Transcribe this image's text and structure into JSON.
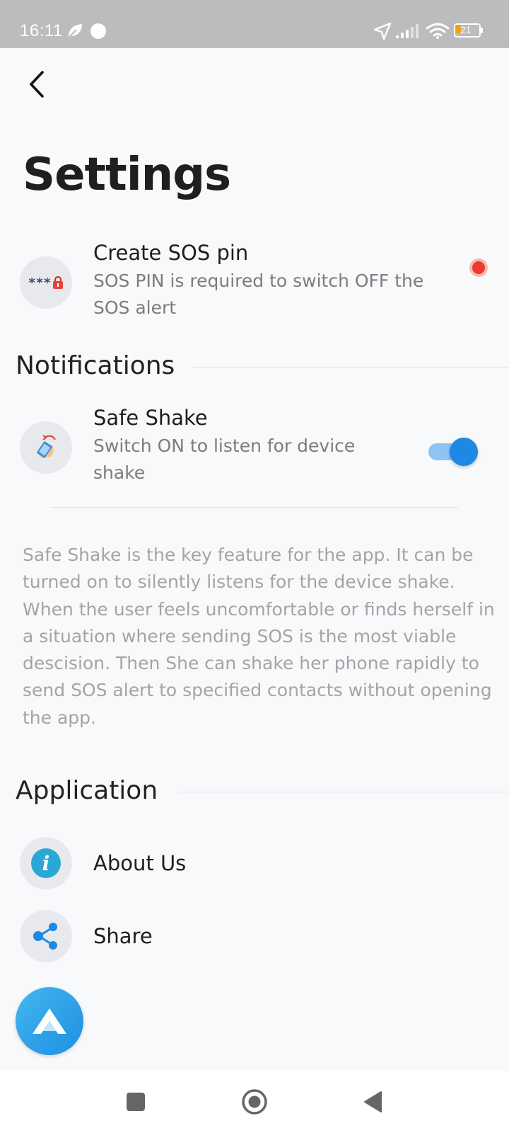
{
  "status_bar": {
    "time": "16:11",
    "battery_level": "21",
    "icons": [
      "leaf-icon",
      "circle-icon",
      "location-arrow-icon",
      "signal-icon",
      "wifi-icon",
      "battery-icon"
    ]
  },
  "header": {
    "back_icon": "chevron-left-icon",
    "title": "Settings"
  },
  "sos_pin": {
    "icon": "password-lock-icon",
    "icon_text": "***",
    "title": "Create SOS pin",
    "subtitle": "SOS PIN is required to switch OFF the SOS alert",
    "indicator_color": "#ec3b2b"
  },
  "notifications": {
    "section_title": "Notifications",
    "safe_shake": {
      "icon": "shake-phone-icon",
      "title": "Safe Shake",
      "subtitle": "Switch ON to listen for device shake",
      "enabled": true
    },
    "description": "Safe Shake is the key feature for the app. It can be turned on to silently listens for the device shake. When the user feels uncomfortable or finds herself in a situation where sending SOS is the most viable descision. Then She can shake her phone rapidly to send SOS alert to specified contacts without opening the app."
  },
  "application": {
    "section_title": "Application",
    "items": [
      {
        "icon": "info-icon",
        "label": "About Us"
      },
      {
        "icon": "share-icon",
        "label": "Share"
      }
    ]
  },
  "fab": {
    "icon": "app-logo-icon"
  },
  "nav_bar": {
    "buttons": [
      "recents-square-icon",
      "home-circle-icon",
      "back-triangle-icon"
    ]
  },
  "colors": {
    "accent": "#1e88e5",
    "toggle_track": "#8ec3f5",
    "info_icon": "#29a8d6",
    "share_icon": "#1e88e5",
    "status_bar": "#bcbcbe",
    "background": "#f8f9fb"
  }
}
